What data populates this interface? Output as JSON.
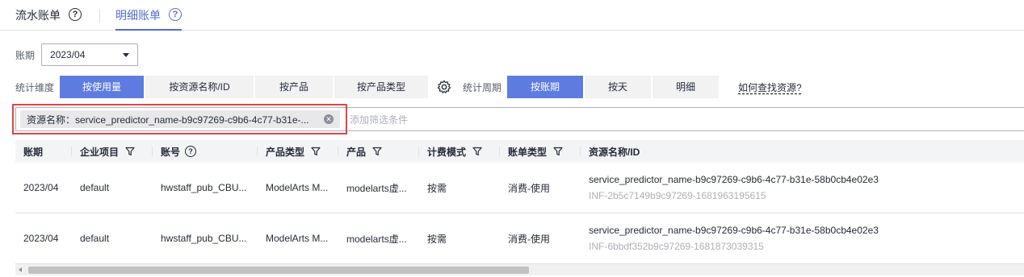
{
  "tabs": [
    {
      "label": "流水账单",
      "active": false
    },
    {
      "label": "明细账单",
      "active": true
    }
  ],
  "period": {
    "label": "账期",
    "value": "2023/04"
  },
  "dimension": {
    "label": "统计维度",
    "options": [
      "按使用量",
      "按资源名称/ID",
      "按产品",
      "按产品类型"
    ],
    "active": "按使用量"
  },
  "cycle": {
    "label": "统计周期",
    "options": [
      "按账期",
      "按天",
      "明细"
    ],
    "active": "按账期"
  },
  "find_resource_link": "如何查找资源?",
  "filter": {
    "chip": "资源名称：service_predictor_name-b9c97269-c9b6-4c77-b31e-...",
    "placeholder": "添加筛选条件"
  },
  "table": {
    "headers": [
      "账期",
      "企业项目",
      "账号",
      "产品类型",
      "产品",
      "计费模式",
      "账单类型",
      "资源名称/ID"
    ],
    "rows": [
      {
        "period": "2023/04",
        "project": "default",
        "account": "hwstaff_pub_CBU...",
        "product_type": "ModelArts M...",
        "product": "modelarts虚...",
        "billing_mode": "按需",
        "bill_type": "消费-使用",
        "resource_name": "service_predictor_name-b9c97269-c9b6-4c77-b31e-58b0cb4e02e3",
        "resource_id": "INF-2b5c7149b9c97269-1681963195615"
      },
      {
        "period": "2023/04",
        "project": "default",
        "account": "hwstaff_pub_CBU...",
        "product_type": "ModelArts M...",
        "product": "modelarts虚...",
        "billing_mode": "按需",
        "bill_type": "消费-使用",
        "resource_name": "service_predictor_name-b9c97269-c9b6-4c77-b31e-58b0cb4e02e3",
        "resource_id": "INF-6bbdf352b9c97269-1681873039315"
      }
    ]
  },
  "colors": {
    "accent": "#5e7ce0",
    "tab_active": "#526ecc",
    "highlight_border": "#e04545"
  }
}
